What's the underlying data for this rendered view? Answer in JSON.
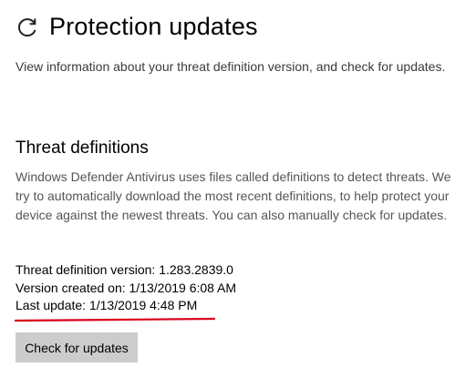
{
  "header": {
    "icon": "refresh-icon",
    "title": "Protection updates",
    "description": "View information about your threat definition version, and check for updates."
  },
  "threat_definitions": {
    "title": "Threat definitions",
    "description": "Windows Defender Antivirus uses files called definitions to detect threats. We try to automatically download the most recent definitions, to help protect your device against the newest threats. You can also manually check for updates.",
    "version_line": "Threat definition version: 1.283.2839.0",
    "created_line": "Version created on: 1/13/2019 6:08 AM",
    "last_update_line": "Last update: 1/13/2019 4:48 PM",
    "annotation_color": "#d9001b"
  },
  "actions": {
    "check_updates_label": "Check for updates"
  }
}
